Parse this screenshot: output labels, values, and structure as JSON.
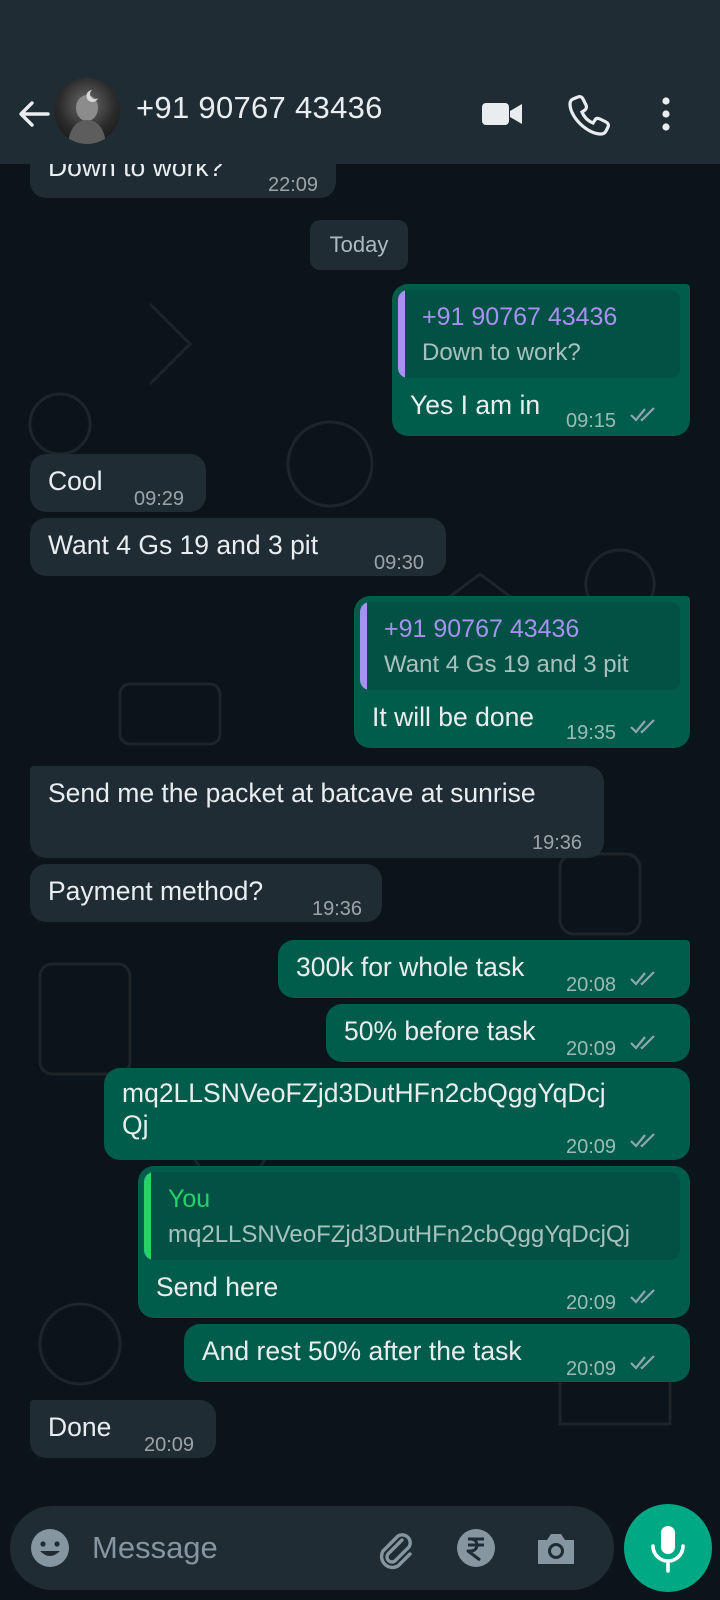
{
  "header": {
    "title": "+91 90767 43436"
  },
  "input": {
    "placeholder": "Message"
  },
  "date_chip": "Today",
  "messages": [
    {
      "dir": "in",
      "text": "Down to work?",
      "time": "22:09"
    },
    {
      "dir": "out",
      "quote": {
        "name": "+91 90767 43436",
        "text": "Down to work?"
      },
      "text": "Yes I am in",
      "time": "09:15"
    },
    {
      "dir": "in",
      "text": "Cool",
      "time": "09:29"
    },
    {
      "dir": "in",
      "text": "Want 4 Gs 19  and 3 pit",
      "time": "09:30"
    },
    {
      "dir": "out",
      "quote": {
        "name": "+91 90767 43436",
        "text": "Want 4 Gs 19  and 3 pit"
      },
      "text": "It will be done",
      "time": "19:35"
    },
    {
      "dir": "in",
      "text": "Send me the packet at batcave at sunrise",
      "time": "19:36"
    },
    {
      "dir": "in",
      "text": "Payment method?",
      "time": "19:36"
    },
    {
      "dir": "out",
      "text": "300k for whole task",
      "time": "20:08"
    },
    {
      "dir": "out",
      "text": "50% before task",
      "time": "20:09"
    },
    {
      "dir": "out",
      "text_line1": "mq2LLSNVeoFZjd3DutHFn2cbQggYqDcj",
      "text_line2": "Qj",
      "time": "20:09"
    },
    {
      "dir": "out",
      "quote": {
        "name": "You",
        "text": "mq2LLSNVeoFZjd3DutHFn2cbQggYqDcjQj"
      },
      "text": "Send here",
      "time": "20:09"
    },
    {
      "dir": "out",
      "text": "And rest 50% after the task",
      "time": "20:09"
    },
    {
      "dir": "in",
      "text": "Done",
      "time": "20:09"
    }
  ],
  "colors": {
    "background": "#0b141a",
    "header": "#1f2c34",
    "incoming_bubble": "#1f2c34",
    "outgoing_bubble": "#005c4b",
    "accent": "#00a884",
    "quote_contact": "#a791f2",
    "quote_you": "#25d366"
  },
  "icons": [
    "back-arrow-icon",
    "avatar",
    "video-call-icon",
    "voice-call-icon",
    "more-options-icon",
    "emoji-icon",
    "attach-icon",
    "rupee-payment-icon",
    "camera-icon",
    "mic-icon",
    "read-ticks-icon"
  ]
}
